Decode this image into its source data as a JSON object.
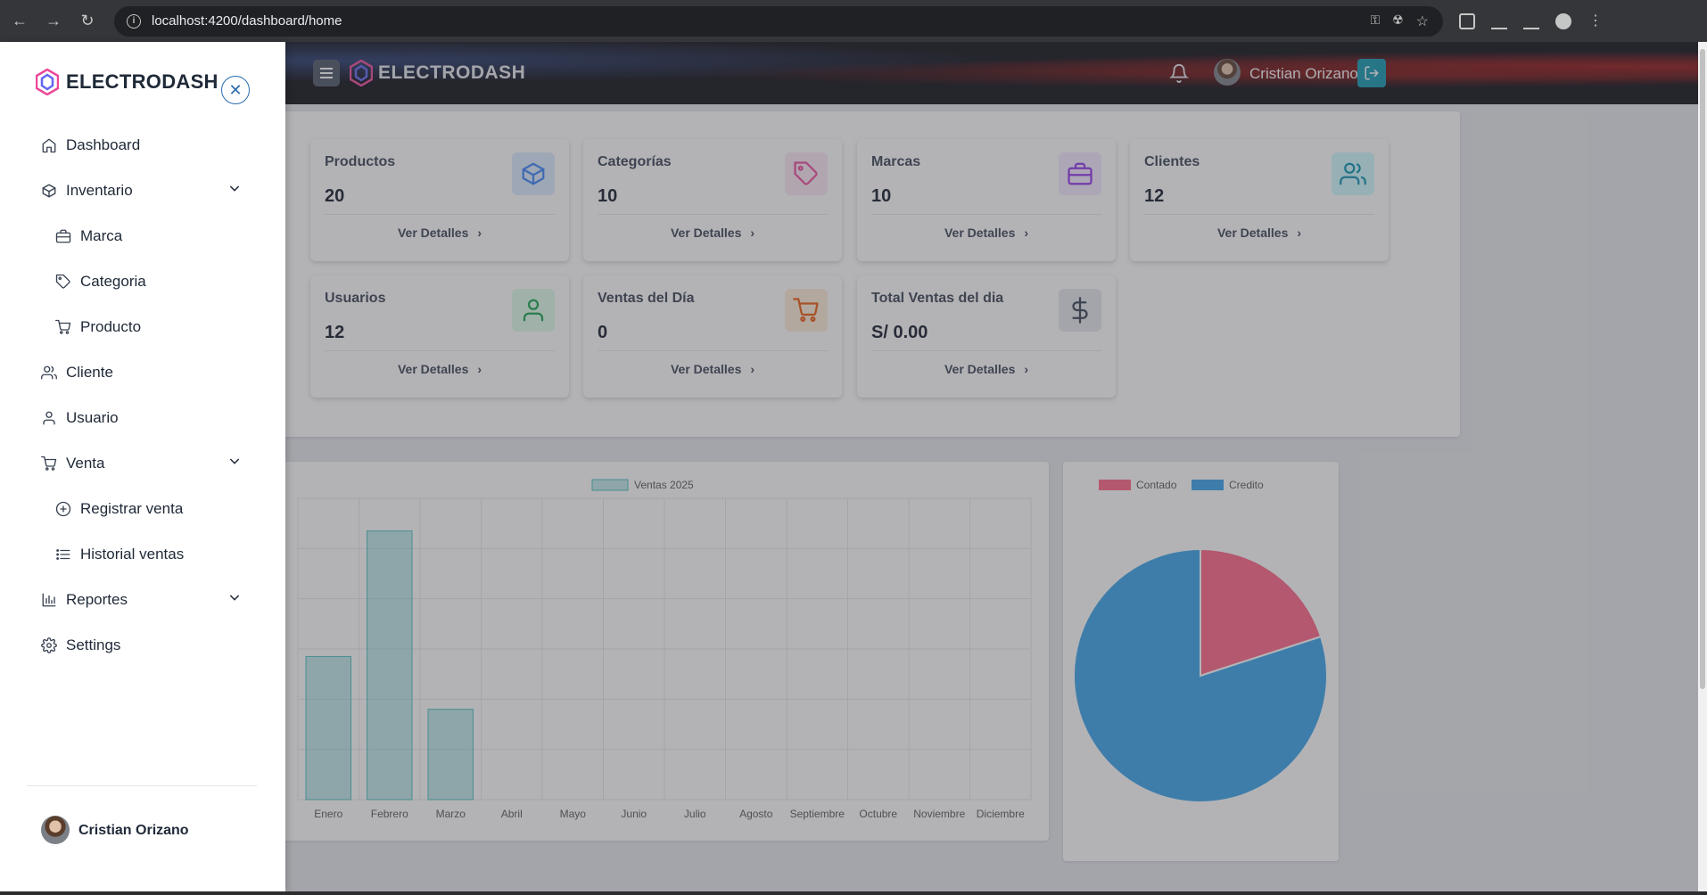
{
  "browser": {
    "url": "localhost:4200/dashboard/home"
  },
  "brand": {
    "name": "ELECTRODASH"
  },
  "topbar": {
    "user_name": "Cristian Orizano"
  },
  "cards": [
    {
      "title": "Productos",
      "value": "20",
      "link": "Ver Detalles",
      "color": "#3b82f6",
      "bg": "#dbeafe",
      "icon": "box-icon"
    },
    {
      "title": "Categorías",
      "value": "10",
      "link": "Ver Detalles",
      "color": "#ec4899",
      "bg": "#fce7f3",
      "icon": "tag-icon"
    },
    {
      "title": "Marcas",
      "value": "10",
      "link": "Ver Detalles",
      "color": "#9333ea",
      "bg": "#f3e8ff",
      "icon": "briefcase-icon"
    },
    {
      "title": "Clientes",
      "value": "12",
      "link": "Ver Detalles",
      "color": "#0891b2",
      "bg": "#cffafe",
      "icon": "users-icon"
    },
    {
      "title": "Usuarios",
      "value": "12",
      "link": "Ver Detalles",
      "color": "#16a34a",
      "bg": "#dcfce7",
      "icon": "user-icon"
    },
    {
      "title": "Ventas del Día",
      "value": "0",
      "link": "Ver Detalles",
      "color": "#ea580c",
      "bg": "#ffedd5",
      "icon": "cart-icon"
    },
    {
      "title": "Total Ventas del dia",
      "value": "S/ 0.00",
      "link": "Ver Detalles",
      "color": "#374151",
      "bg": "#e5e7eb",
      "icon": "dollar-icon"
    }
  ],
  "sidebar": {
    "items": [
      {
        "label": "Dashboard",
        "icon": "home-icon"
      },
      {
        "label": "Inventario",
        "icon": "box-icon",
        "expandable": true
      },
      {
        "label": "Marca",
        "icon": "briefcase-icon",
        "sub": true
      },
      {
        "label": "Categoria",
        "icon": "tag-icon",
        "sub": true
      },
      {
        "label": "Producto",
        "icon": "cart-icon",
        "sub": true
      },
      {
        "label": "Cliente",
        "icon": "users-icon"
      },
      {
        "label": "Usuario",
        "icon": "user-icon"
      },
      {
        "label": "Venta",
        "icon": "cart-icon",
        "expandable": true
      },
      {
        "label": "Registrar venta",
        "icon": "plus-circle-icon",
        "sub": true
      },
      {
        "label": "Historial ventas",
        "icon": "list-icon",
        "sub": true
      },
      {
        "label": "Reportes",
        "icon": "bar-chart-icon",
        "expandable": true
      },
      {
        "label": "Settings",
        "icon": "gear-icon"
      }
    ],
    "user_name": "Cristian Orizano"
  },
  "chart_data": [
    {
      "type": "bar",
      "categories": [
        "Enero",
        "Febrero",
        "Marzo",
        "Abril",
        "Mayo",
        "Junio",
        "Julio",
        "Agosto",
        "Septiembre",
        "Octubre",
        "Noviembre",
        "Diciembre"
      ],
      "series": [
        {
          "name": "Ventas 2025",
          "values": [
            2.85,
            5.35,
            1.8,
            0,
            0,
            0,
            0,
            0,
            0,
            0,
            0,
            0
          ],
          "color": "#4bc0c0"
        }
      ],
      "ylim": [
        0,
        6
      ],
      "grid": true,
      "legend": "top"
    },
    {
      "type": "pie",
      "labels": [
        "Contado",
        "Credito"
      ],
      "values": [
        20,
        80
      ],
      "colors": [
        "#ff6384",
        "#36a2eb"
      ],
      "legend": "top"
    }
  ]
}
